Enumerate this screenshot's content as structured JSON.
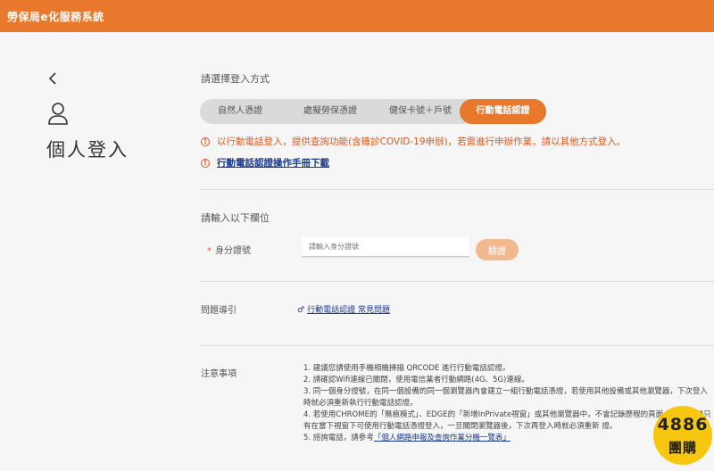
{
  "header": {
    "title": "勞保局e化服務系統"
  },
  "page": {
    "title": "個人登入"
  },
  "login_method": {
    "label": "請選擇登入方式",
    "tabs": [
      {
        "label": "自然人憑證"
      },
      {
        "label": "處擬勞保憑證"
      },
      {
        "label": "健保卡號＋戶號"
      },
      {
        "label": "行動電話認證"
      }
    ],
    "active_tab": "行動電話認證"
  },
  "notices": {
    "covid": "以行動電話登入，提供查詢功能(含確診COVID-19申辦)，若需進行申辦作業，請以其他方式登入。",
    "manual_link": "行動電話認證操作手冊下載"
  },
  "form": {
    "section_label": "請輸入以下欄位",
    "required_mark": "*",
    "id_label": "身分證號",
    "id_placeholder": "請輸入身分證號",
    "verify_button": "驗證"
  },
  "faq": {
    "label": "問題導引",
    "link_text": "行動電話認證 常見問題"
  },
  "notes": {
    "label": "注意事項",
    "items": [
      "1. 建議您請使用手機相機掃描 QRCODE 進行行動電話認證。",
      "2. 請確認Wifi連線已關閉，使用電信業者行動網路(4G、5G)連線。",
      "3. 同一個身分證號，在同一個設備的同一個瀏覽器內會建立一組行動電話憑證，若使用其他設備或其他瀏覽器，下次登入時就必須重新執行行動電話認證。",
      "4. 若使用CHROME的「無痕模式」、EDGE的「新增InPrivate視窗」或其他瀏覽器中，不會記錄歷程的頁面 認證，系統只有在當下視窗下可使用行動電話憑證登入，一旦關閉瀏覽器後，下次再登入時就必須重新 證。",
      "5. 諮詢電話，請參考"
    ],
    "item5_link": "「個人網路申報及查詢作業分機一覽表」"
  },
  "watermark": {
    "number": "4886",
    "text": "團購"
  },
  "colors": {
    "brand": "#e8782b",
    "alert": "#e0571e",
    "link": "#1a3a8a"
  }
}
